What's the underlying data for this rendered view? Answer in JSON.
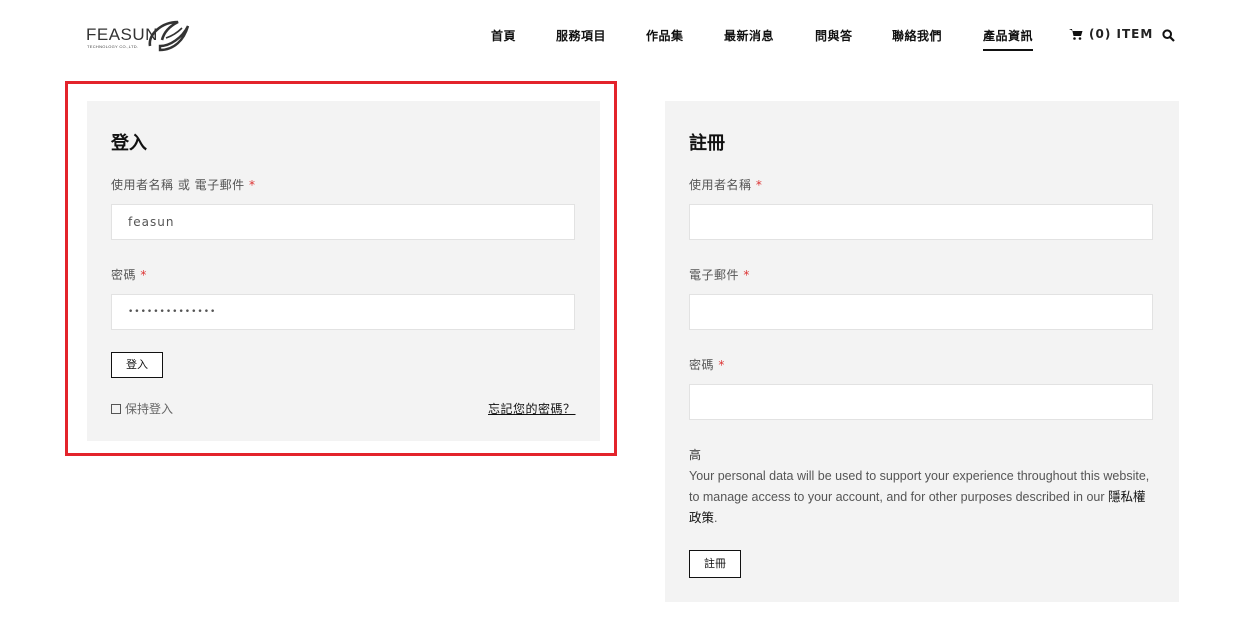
{
  "logo": {
    "name": "FEASUN",
    "subtitle": "TECHNOLOGY CO.,LTD."
  },
  "nav": {
    "items": [
      {
        "label": "首頁"
      },
      {
        "label": "服務項目"
      },
      {
        "label": "作品集"
      },
      {
        "label": "最新消息"
      },
      {
        "label": "問與答"
      },
      {
        "label": "聯絡我們"
      },
      {
        "label": "產品資訊",
        "active": true
      }
    ],
    "cart_label": "(0) ITEM",
    "cart_icon": "shopping-cart-icon",
    "search_icon": "search-icon"
  },
  "login": {
    "title": "登入",
    "username_label": "使用者名稱 或 電子郵件",
    "username_value": "feasun",
    "password_label": "密碼",
    "password_value": "••••••••••••••",
    "required_mark": "*",
    "submit_label": "登入",
    "remember_label": "保持登入",
    "forgot_label": "忘記您的密碼？"
  },
  "register": {
    "title": "註冊",
    "username_label": "使用者名稱",
    "email_label": "電子郵件",
    "password_label": "密碼",
    "required_mark": "*",
    "char_text": "高",
    "privacy_text": "Your personal data will be used to support your experience throughout this website, to manage access to your account, and for other purposes described in our ",
    "privacy_link": "隱私權政策",
    "privacy_end": ".",
    "submit_label": "註冊"
  },
  "colors": {
    "highlight": "#e3232b",
    "panel_bg": "#f3f3f3",
    "required": "#dd3333"
  }
}
